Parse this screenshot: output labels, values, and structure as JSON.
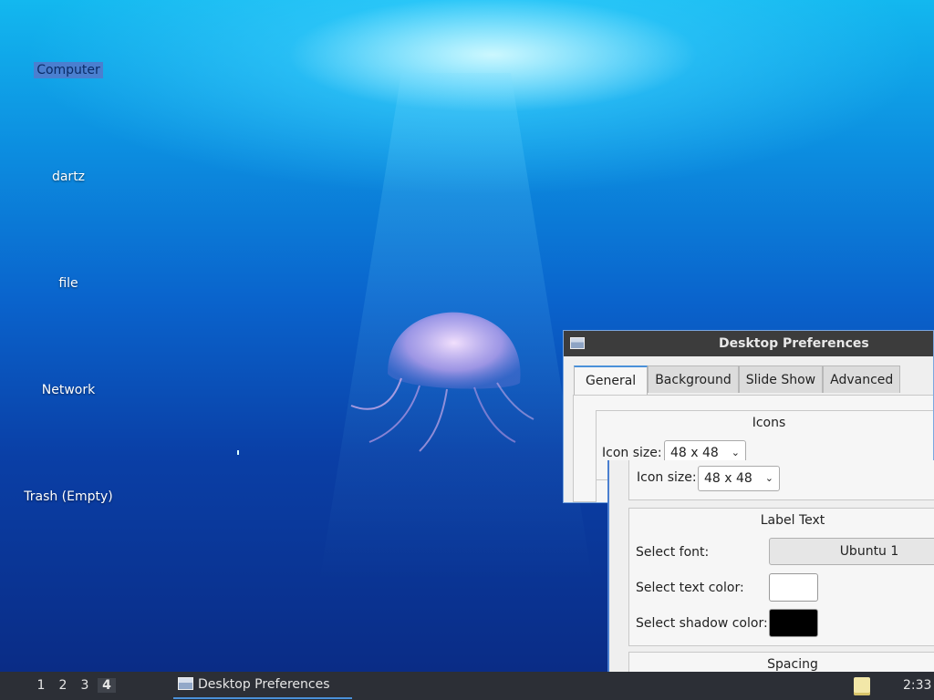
{
  "desktop": {
    "icons": [
      {
        "label": "Computer",
        "selected": true
      },
      {
        "label": "dartz"
      },
      {
        "label": "file"
      },
      {
        "label": "Network"
      },
      {
        "label": "Trash (Empty)"
      }
    ]
  },
  "dialog": {
    "title": "Desktop Preferences",
    "tabs": [
      "General",
      "Background",
      "Slide Show",
      "Advanced"
    ],
    "active_tab": "General",
    "icons_group": {
      "title": "Icons",
      "icon_size_label": "Icon size:",
      "icon_size_value": "48 x 48"
    },
    "label_text_group": {
      "title": "Label Text",
      "select_font_label": "Select font:",
      "font_value": "Ubuntu 1",
      "text_color_label": "Select text color:",
      "text_color": "#ffffff",
      "shadow_color_label": "Select shadow color:",
      "shadow_color": "#000000"
    },
    "spacing_group": {
      "title": "Spacing"
    }
  },
  "panel": {
    "workspaces": [
      "1",
      "2",
      "3",
      "4"
    ],
    "active_workspace": "4",
    "task_label": "Desktop Preferences",
    "clock": "2:33"
  },
  "colors": {
    "accent": "#4a90d9",
    "panel_bg": "#2c2f36",
    "titlebar_bg": "#3c3c3c"
  }
}
